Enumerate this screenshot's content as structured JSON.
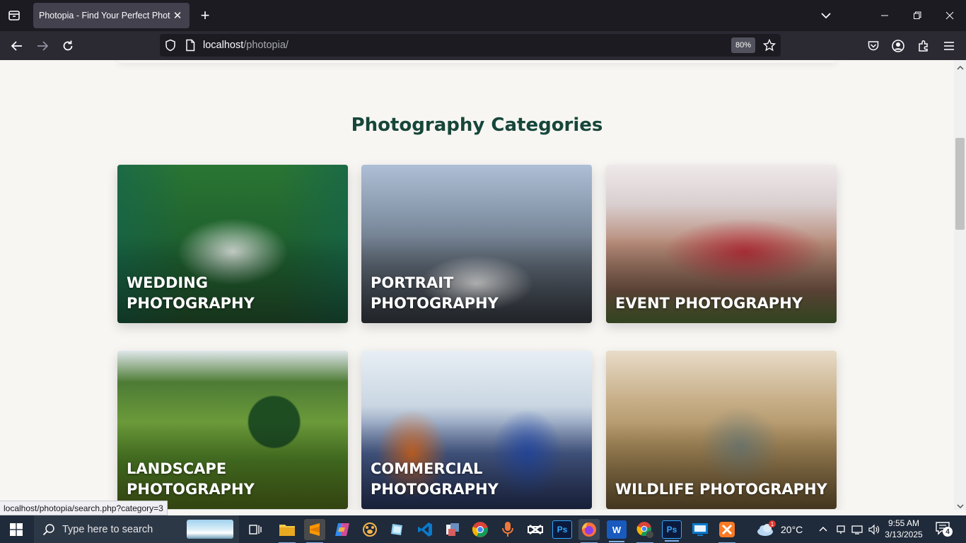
{
  "browser": {
    "tab_title": "Photopia - Find Your Perfect Photog",
    "url_host": "localhost",
    "url_path": "/photopia/",
    "zoom": "80%",
    "status_link": "localhost/photopia/search.php?category=3"
  },
  "page": {
    "section_title": "Photography Categories",
    "categories": [
      {
        "label": "WEDDING PHOTOGRAPHY"
      },
      {
        "label": "PORTRAIT PHOTOGRAPHY"
      },
      {
        "label": "EVENT PHOTOGRAPHY"
      },
      {
        "label": "LANDSCAPE PHOTOGRAPHY"
      },
      {
        "label": "COMMERCIAL PHOTOGRAPHY"
      },
      {
        "label": "WILDLIFE PHOTOGRAPHY"
      }
    ]
  },
  "taskbar": {
    "search_placeholder": "Type here to search",
    "weather_temp": "20°C",
    "weather_badge": "1",
    "time": "9:55 AM",
    "date": "3/13/2025",
    "notification_count": "4",
    "apps": [
      {
        "name": "task-view-icon"
      },
      {
        "name": "file-explorer-icon"
      },
      {
        "name": "sublime-text-icon"
      },
      {
        "name": "copilot-icon"
      },
      {
        "name": "paw-app-icon"
      },
      {
        "name": "notes-app-icon"
      },
      {
        "name": "vscode-icon"
      },
      {
        "name": "database-tool-icon"
      },
      {
        "name": "chrome-icon"
      },
      {
        "name": "microphone-app-icon"
      },
      {
        "name": "capcut-icon"
      },
      {
        "name": "photoshop-icon"
      },
      {
        "name": "firefox-icon"
      },
      {
        "name": "word-icon"
      },
      {
        "name": "chrome-profile-icon"
      },
      {
        "name": "photoshop-2-icon"
      },
      {
        "name": "remote-desktop-icon"
      },
      {
        "name": "xampp-icon"
      }
    ]
  }
}
